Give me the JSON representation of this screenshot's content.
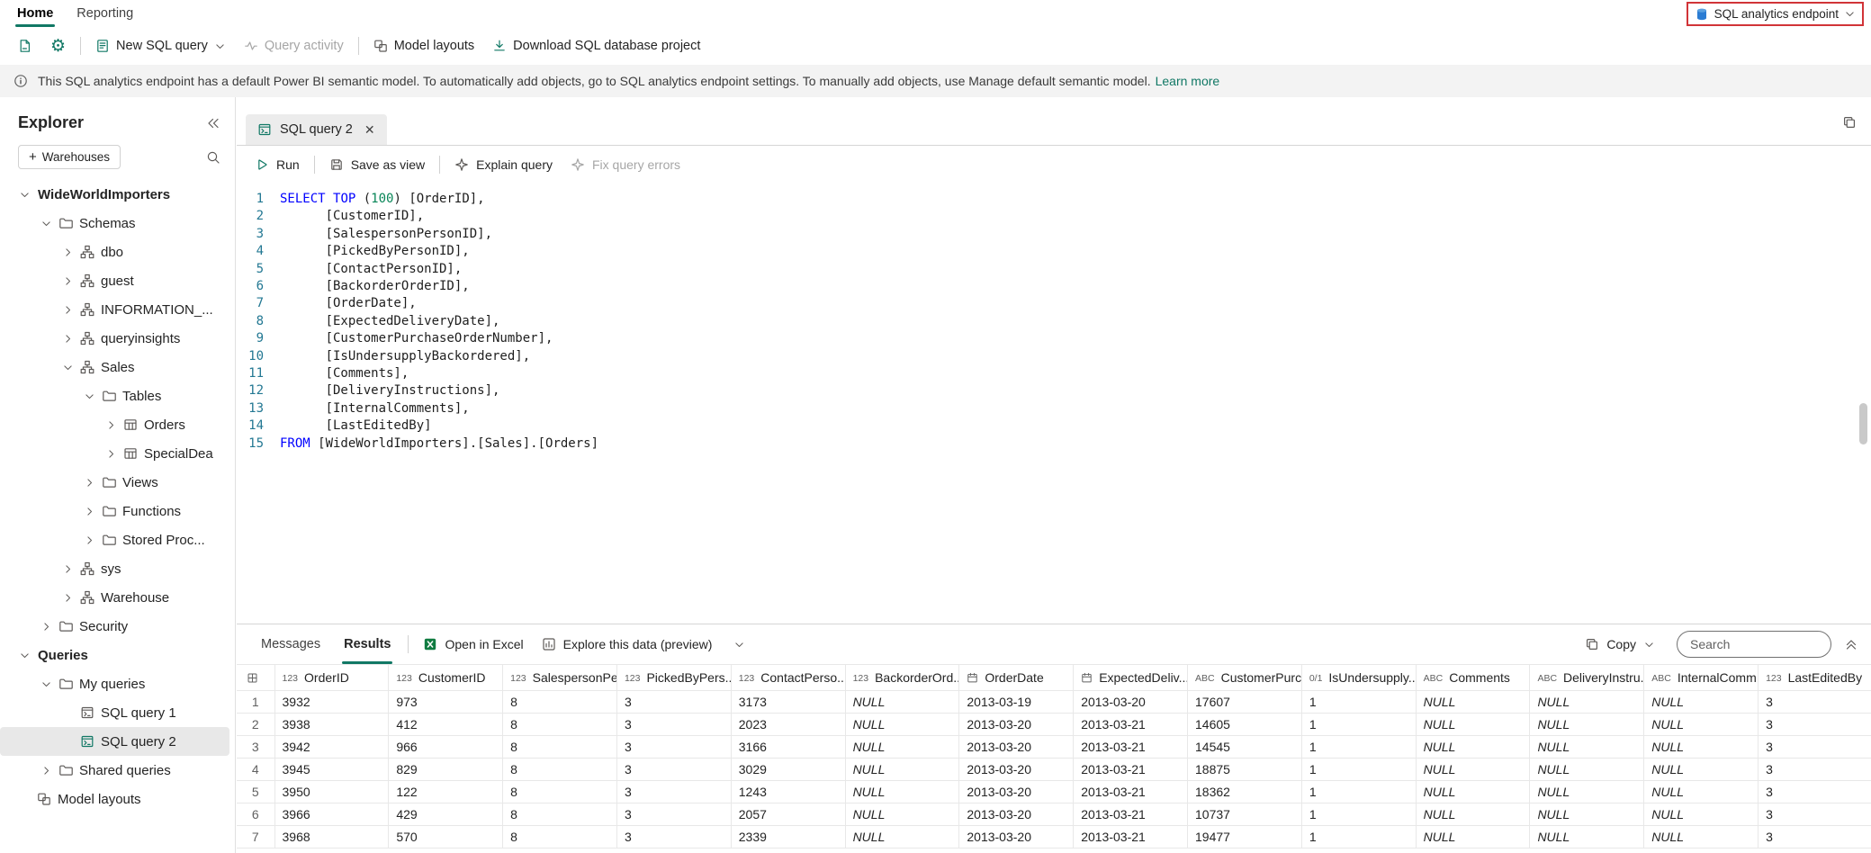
{
  "colors": {
    "accent": "#117865",
    "highlight_border": "#d13438",
    "keyword": "#0000ff",
    "number": "#098658"
  },
  "ribbon": {
    "tabs": [
      {
        "label": "Home",
        "active": true
      },
      {
        "label": "Reporting",
        "active": false
      }
    ],
    "endpoint_label": "SQL analytics endpoint"
  },
  "toolbar": {
    "new_sql_query": "New SQL query",
    "query_activity": "Query activity",
    "model_layouts": "Model layouts",
    "download_project": "Download SQL database project"
  },
  "banner": {
    "text": "This SQL analytics endpoint has a default Power BI semantic model. To automatically add objects, go to SQL analytics endpoint settings. To manually add objects, use Manage default semantic model.",
    "learn_more": "Learn more"
  },
  "explorer": {
    "title": "Explorer",
    "warehouses_button": "Warehouses",
    "tree": [
      {
        "label": "WideWorldImporters",
        "level": 0,
        "chevron": "down",
        "icon": "none",
        "bold": true
      },
      {
        "label": "Schemas",
        "level": 1,
        "chevron": "down",
        "icon": "folder"
      },
      {
        "label": "dbo",
        "level": 2,
        "chevron": "right",
        "icon": "schema"
      },
      {
        "label": "guest",
        "level": 2,
        "chevron": "right",
        "icon": "schema"
      },
      {
        "label": "INFORMATION_...",
        "level": 2,
        "chevron": "right",
        "icon": "schema"
      },
      {
        "label": "queryinsights",
        "level": 2,
        "chevron": "right",
        "icon": "schema"
      },
      {
        "label": "Sales",
        "level": 2,
        "chevron": "down",
        "icon": "schema"
      },
      {
        "label": "Tables",
        "level": 3,
        "chevron": "down",
        "icon": "folder"
      },
      {
        "label": "Orders",
        "level": 4,
        "chevron": "right",
        "icon": "table"
      },
      {
        "label": "SpecialDea",
        "level": 4,
        "chevron": "right",
        "icon": "table"
      },
      {
        "label": "Views",
        "level": 3,
        "chevron": "right",
        "icon": "folder"
      },
      {
        "label": "Functions",
        "level": 3,
        "chevron": "right",
        "icon": "folder"
      },
      {
        "label": "Stored Proc...",
        "level": 3,
        "chevron": "right",
        "icon": "folder"
      },
      {
        "label": "sys",
        "level": 2,
        "chevron": "right",
        "icon": "schema"
      },
      {
        "label": "Warehouse",
        "level": 2,
        "chevron": "right",
        "icon": "schema"
      },
      {
        "label": "Security",
        "level": 1,
        "chevron": "right",
        "icon": "folder"
      },
      {
        "label": "Queries",
        "level": 0,
        "chevron": "down",
        "icon": "none",
        "bold": true
      },
      {
        "label": "My queries",
        "level": 1,
        "chevron": "down",
        "icon": "folder"
      },
      {
        "label": "SQL query 1",
        "level": 2,
        "chevron": "none",
        "icon": "query"
      },
      {
        "label": "SQL query 2",
        "level": 2,
        "chevron": "none",
        "icon": "query",
        "selected": true
      },
      {
        "label": "Shared queries",
        "level": 1,
        "chevron": "right",
        "icon": "folder"
      },
      {
        "label": "Model layouts",
        "level": 0,
        "chevron": "none",
        "icon": "model"
      }
    ]
  },
  "editor": {
    "tab_label": "SQL query 2",
    "toolbar": {
      "run": "Run",
      "save_as_view": "Save as view",
      "explain_query": "Explain query",
      "fix_query_errors": "Fix query errors"
    },
    "code_lines": [
      "SELECT TOP (100) [OrderID],",
      "      [CustomerID],",
      "      [SalespersonPersonID],",
      "      [PickedByPersonID],",
      "      [ContactPersonID],",
      "      [BackorderOrderID],",
      "      [OrderDate],",
      "      [ExpectedDeliveryDate],",
      "      [CustomerPurchaseOrderNumber],",
      "      [IsUndersupplyBackordered],",
      "      [Comments],",
      "      [DeliveryInstructions],",
      "      [InternalComments],",
      "      [LastEditedBy]",
      "FROM [WideWorldImporters].[Sales].[Orders]"
    ]
  },
  "results": {
    "tabs": {
      "messages": "Messages",
      "results": "Results"
    },
    "open_in_excel": "Open in Excel",
    "explore_data": "Explore this data (preview)",
    "copy": "Copy",
    "search_placeholder": "Search",
    "columns": [
      {
        "label": "OrderID",
        "type": "int"
      },
      {
        "label": "CustomerID",
        "type": "int"
      },
      {
        "label": "SalespersonPe...",
        "type": "int"
      },
      {
        "label": "PickedByPers...",
        "type": "int"
      },
      {
        "label": "ContactPerso...",
        "type": "int"
      },
      {
        "label": "BackorderOrd...",
        "type": "int"
      },
      {
        "label": "OrderDate",
        "type": "date"
      },
      {
        "label": "ExpectedDeliv...",
        "type": "date"
      },
      {
        "label": "CustomerPurc...",
        "type": "str"
      },
      {
        "label": "IsUndersupply...",
        "type": "bit"
      },
      {
        "label": "Comments",
        "type": "str"
      },
      {
        "label": "DeliveryInstru...",
        "type": "str"
      },
      {
        "label": "InternalComm...",
        "type": "str"
      },
      {
        "label": "LastEditedBy",
        "type": "int"
      }
    ],
    "rows": [
      [
        "3932",
        "973",
        "8",
        "3",
        "3173",
        "NULL",
        "2013-03-19",
        "2013-03-20",
        "17607",
        "1",
        "NULL",
        "NULL",
        "NULL",
        "3"
      ],
      [
        "3938",
        "412",
        "8",
        "3",
        "2023",
        "NULL",
        "2013-03-20",
        "2013-03-21",
        "14605",
        "1",
        "NULL",
        "NULL",
        "NULL",
        "3"
      ],
      [
        "3942",
        "966",
        "8",
        "3",
        "3166",
        "NULL",
        "2013-03-20",
        "2013-03-21",
        "14545",
        "1",
        "NULL",
        "NULL",
        "NULL",
        "3"
      ],
      [
        "3945",
        "829",
        "8",
        "3",
        "3029",
        "NULL",
        "2013-03-20",
        "2013-03-21",
        "18875",
        "1",
        "NULL",
        "NULL",
        "NULL",
        "3"
      ],
      [
        "3950",
        "122",
        "8",
        "3",
        "1243",
        "NULL",
        "2013-03-20",
        "2013-03-21",
        "18362",
        "1",
        "NULL",
        "NULL",
        "NULL",
        "3"
      ],
      [
        "3966",
        "429",
        "8",
        "3",
        "2057",
        "NULL",
        "2013-03-20",
        "2013-03-21",
        "10737",
        "1",
        "NULL",
        "NULL",
        "NULL",
        "3"
      ],
      [
        "3968",
        "570",
        "8",
        "3",
        "2339",
        "NULL",
        "2013-03-20",
        "2013-03-21",
        "19477",
        "1",
        "NULL",
        "NULL",
        "NULL",
        "3"
      ]
    ]
  }
}
